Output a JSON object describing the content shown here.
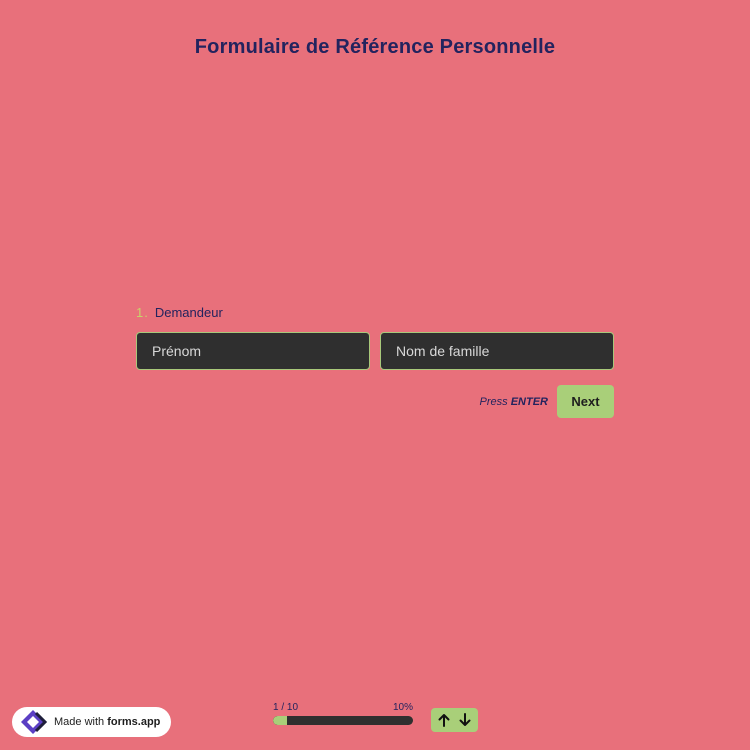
{
  "form": {
    "title": "Formulaire de Référence Personnelle"
  },
  "question": {
    "number": "1",
    "dot": ".",
    "label": "Demandeur",
    "fields": {
      "first_name_placeholder": "Prénom",
      "last_name_placeholder": "Nom de famille",
      "first_name_value": "",
      "last_name_value": ""
    }
  },
  "actions": {
    "press_prefix": "Press",
    "press_key": "ENTER",
    "next_label": "Next"
  },
  "progress": {
    "step_text": "1 / 10",
    "percent_text": "10%",
    "percent": 10
  },
  "badge": {
    "prefix": "Made with",
    "brand": "forms.app"
  },
  "icons": {
    "up": "arrow-up-icon",
    "down": "arrow-down-icon",
    "logo": "forms-app-logo-icon"
  },
  "colors": {
    "background": "#e8707b",
    "accent": "#a9cf79",
    "text": "#23235e",
    "field_bg": "#2f2f2f",
    "number": "#c8d36a"
  }
}
